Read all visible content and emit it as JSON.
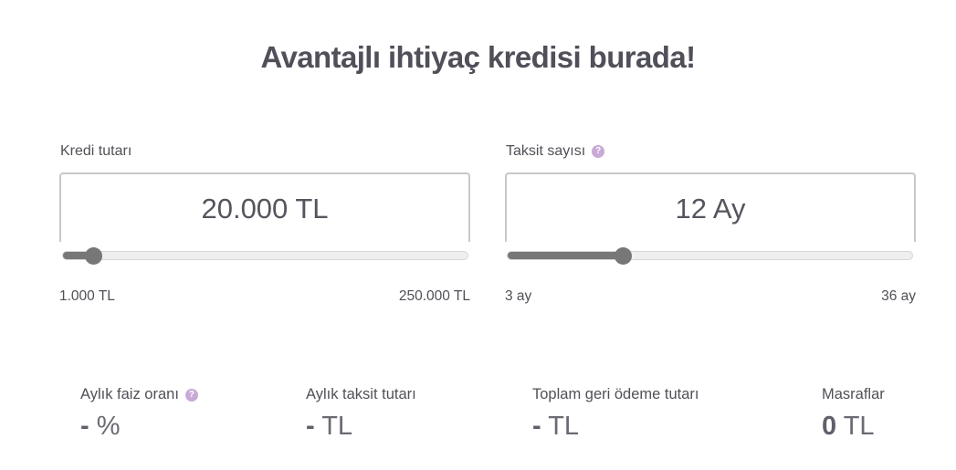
{
  "title": "Avantajlı ihtiyaç kredisi burada!",
  "loan_amount": {
    "label": "Kredi tutarı",
    "value": "20.000 TL",
    "min_label": "1.000 TL",
    "max_label": "250.000 TL",
    "slider_fraction": 0.076
  },
  "installments": {
    "label": "Taksit sayısı",
    "help": "?",
    "value": "12 Ay",
    "min_label": "3 ay",
    "max_label": "36 ay",
    "slider_fraction": 0.285
  },
  "stats": [
    {
      "label": "Aylık faiz oranı",
      "help": "?",
      "value": "-",
      "unit": "%"
    },
    {
      "label": "Aylık taksit tutarı",
      "value": "-",
      "unit": "TL"
    },
    {
      "label": "Toplam geri ödeme tutarı",
      "value": "-",
      "unit": "TL"
    },
    {
      "label": "Masraflar",
      "value": "0",
      "unit": "TL"
    }
  ],
  "colors": {
    "slider_fill": "#777777",
    "help_icon": "#c9a9d6",
    "text": "#50505a"
  }
}
